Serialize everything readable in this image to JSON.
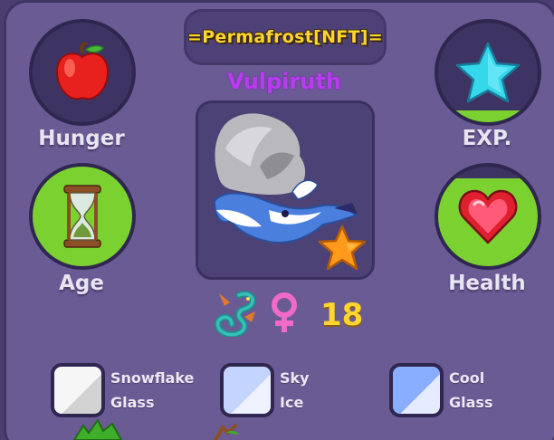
{
  "pet": {
    "tag": "=Permafrost[NFT]=",
    "name": "Vulpiruth",
    "count": "18",
    "gender": "female"
  },
  "stats": {
    "hunger": {
      "label": "Hunger",
      "icon": "apple-icon",
      "fill": 0
    },
    "exp": {
      "label": "EXP.",
      "icon": "star-icon",
      "fill": 0.12
    },
    "age": {
      "label": "Age",
      "icon": "hourglass-icon",
      "fill": 1
    },
    "health": {
      "label": "Health",
      "icon": "heart-icon",
      "fill": 0.88
    }
  },
  "swatches": [
    {
      "line1": "Snowflake",
      "line2": "Glass",
      "color_a": "#f4f4f4",
      "color_b": "#d9d9d9"
    },
    {
      "line1": "Sky",
      "line2": "Ice",
      "color_a": "#c9d8ff",
      "color_b": "#eef3ff"
    },
    {
      "line1": "Cool",
      "line2": "Glass",
      "color_a": "#8fb2ff",
      "color_b": "#e6ecff"
    }
  ],
  "colors": {
    "panel": "#6b5b95",
    "stat_fill": "#7bd12f",
    "title": "#ffd52e",
    "name": "#b93bf0"
  }
}
